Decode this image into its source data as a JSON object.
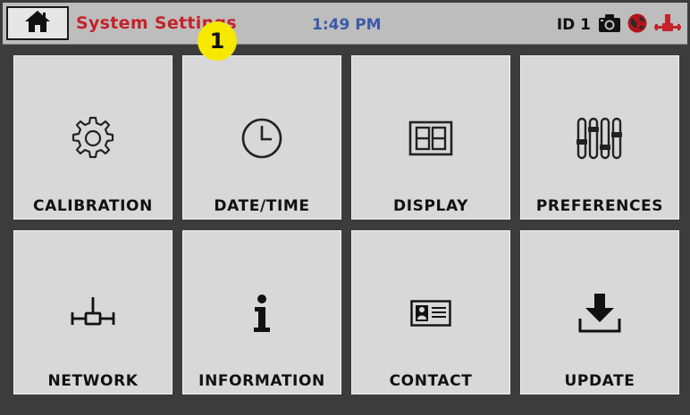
{
  "header": {
    "home_icon": "home-icon",
    "title": "System Settings",
    "time": "1:49 PM",
    "device_id": "ID 1",
    "status_icons": [
      "camera-icon",
      "globe-icon",
      "network-icon"
    ]
  },
  "callout": {
    "label": "1"
  },
  "tiles": [
    {
      "label": "CALIBRATION",
      "icon": "gear-icon"
    },
    {
      "label": "DATE/TIME",
      "icon": "clock-icon"
    },
    {
      "label": "DISPLAY",
      "icon": "display-icon"
    },
    {
      "label": "PREFERENCES",
      "icon": "sliders-icon"
    },
    {
      "label": "NETWORK",
      "icon": "network-icon"
    },
    {
      "label": "INFORMATION",
      "icon": "info-icon"
    },
    {
      "label": "CONTACT",
      "icon": "contact-card-icon"
    },
    {
      "label": "UPDATE",
      "icon": "download-icon"
    }
  ],
  "colors": {
    "title": "#c4232b",
    "time": "#3c5aa8",
    "callout": "#f7e800",
    "tile": "#d8d8d8",
    "background": "#3c3c3c"
  }
}
